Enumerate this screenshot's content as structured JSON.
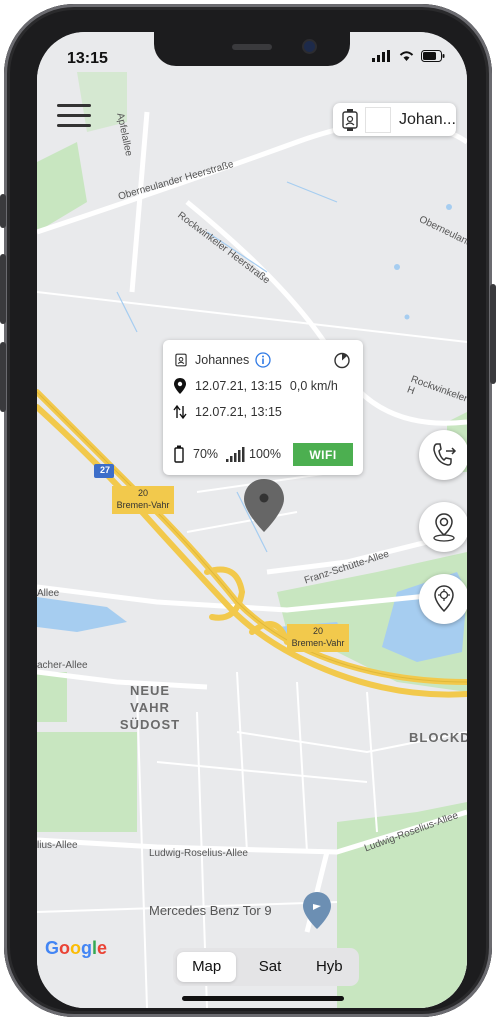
{
  "status_bar": {
    "time": "13:15"
  },
  "map": {
    "streets": [
      "Apfelallee",
      "Oberneulander Heerstraße",
      "Rockwinkeler Heerstraße",
      "Oberneulande",
      "Rockwinkeler H",
      "Franz-Schütte-Allee",
      "Allee",
      "acher-Allee",
      "lius-Allee",
      "Ludwig-Roselius-Allee",
      "Ludwig-Roselius-Allee"
    ],
    "route_shield": "27",
    "exit_labels": [
      {
        "number": "20",
        "name": "Bremen-Vahr"
      },
      {
        "number": "20",
        "name": "Bremen-Vahr"
      }
    ],
    "districts": [
      "NEUE VAHR",
      "SÜDOST",
      "BLOCKDI"
    ],
    "poi": "Mercedes Benz Tor 9",
    "google_logo": "Google"
  },
  "device_selector": {
    "name": "Johan..."
  },
  "info_card": {
    "name": "Johannes",
    "location_time": "12.07.21, 13:15",
    "speed": "0,0 km/h",
    "sync_time": "12.07.21, 13:15",
    "battery": "70%",
    "signal": "100%",
    "connection": "WIFI"
  },
  "map_type": {
    "options": [
      "Map",
      "Sat",
      "Hyb"
    ],
    "selected": "Map"
  },
  "colors": {
    "wifi": "#4caf50",
    "motorway": "#f2c94c",
    "park": "#c8e6c0",
    "water": "#a6cdf0",
    "pin": "#666666",
    "poi_pin": "#6c8fb3"
  }
}
